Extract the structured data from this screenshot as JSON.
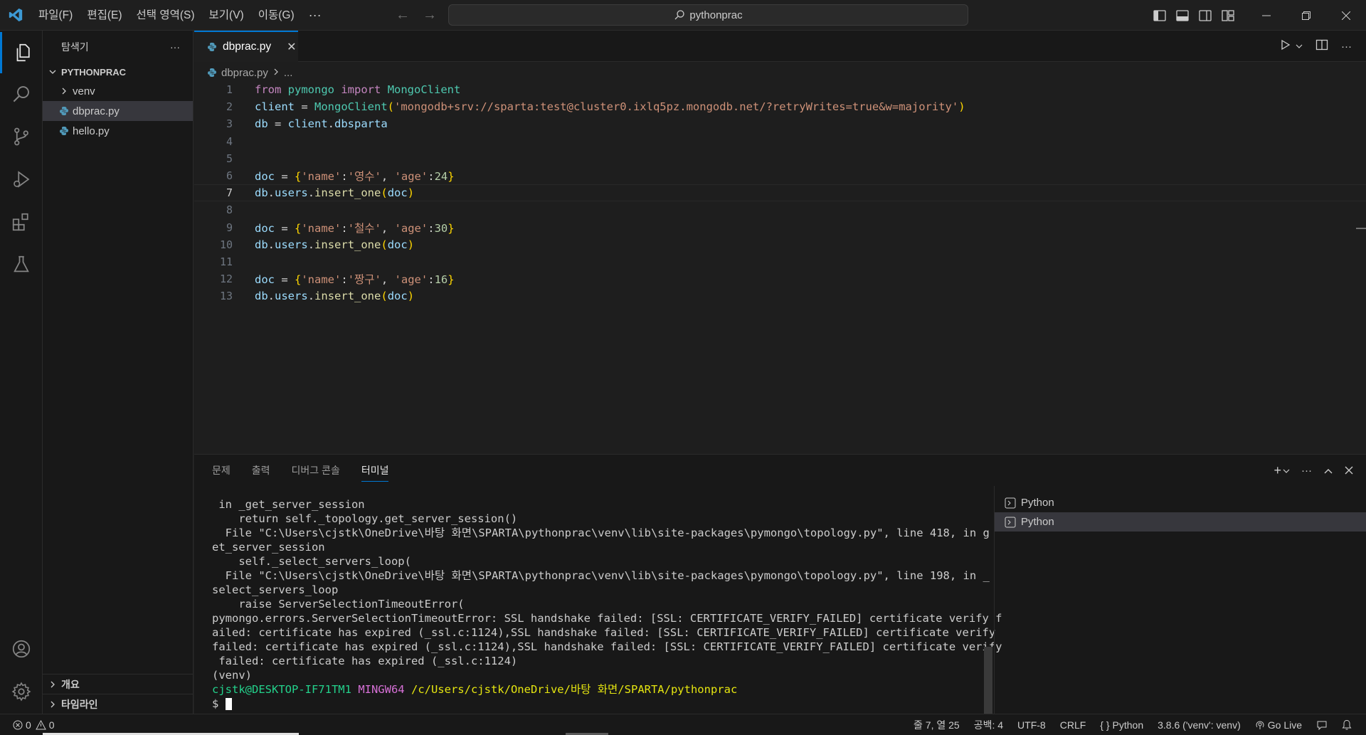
{
  "menu": {
    "items": [
      "파일(F)",
      "편집(E)",
      "선택 영역(S)",
      "보기(V)",
      "이동(G)"
    ],
    "more": "···"
  },
  "search": {
    "text": "pythonprac"
  },
  "sidebar": {
    "title": "탐색기",
    "more": "···",
    "project": "PYTHONPRAC",
    "tree": [
      {
        "label": "venv",
        "type": "folder"
      },
      {
        "label": "dbprac.py",
        "type": "file",
        "selected": true
      },
      {
        "label": "hello.py",
        "type": "file"
      }
    ],
    "outline": "개요",
    "timeline": "타임라인"
  },
  "editor": {
    "tab_label": "dbprac.py",
    "breadcrumb_file": "dbprac.py",
    "breadcrumb_rest": "...",
    "current_line": 7,
    "lines": [
      {
        "n": "1",
        "parts": [
          [
            "kw",
            "from"
          ],
          [
            "op",
            " "
          ],
          [
            "mod",
            "pymongo"
          ],
          [
            "op",
            " "
          ],
          [
            "kw",
            "import"
          ],
          [
            "op",
            " "
          ],
          [
            "mod",
            "MongoClient"
          ]
        ]
      },
      {
        "n": "2",
        "parts": [
          [
            "var",
            "client"
          ],
          [
            "op",
            " = "
          ],
          [
            "mod",
            "MongoClient"
          ],
          [
            "br1",
            "("
          ],
          [
            "str",
            "'mongodb+srv://sparta:test@cluster0.ixlq5pz.mongodb.net/?retryWrites=true&w=majority'"
          ],
          [
            "br1",
            ")"
          ]
        ]
      },
      {
        "n": "3",
        "parts": [
          [
            "var",
            "db"
          ],
          [
            "op",
            " = "
          ],
          [
            "var",
            "client"
          ],
          [
            "op",
            "."
          ],
          [
            "var",
            "dbsparta"
          ]
        ]
      },
      {
        "n": "4",
        "parts": []
      },
      {
        "n": "5",
        "parts": []
      },
      {
        "n": "6",
        "parts": [
          [
            "var",
            "doc"
          ],
          [
            "op",
            " = "
          ],
          [
            "br1",
            "{"
          ],
          [
            "str",
            "'name'"
          ],
          [
            "op",
            ":"
          ],
          [
            "str",
            "'영수'"
          ],
          [
            "op",
            ", "
          ],
          [
            "str",
            "'age'"
          ],
          [
            "op",
            ":"
          ],
          [
            "num",
            "24"
          ],
          [
            "br1",
            "}"
          ]
        ]
      },
      {
        "n": "7",
        "parts": [
          [
            "var",
            "db"
          ],
          [
            "op",
            "."
          ],
          [
            "var",
            "users"
          ],
          [
            "op",
            "."
          ],
          [
            "fn",
            "insert_one"
          ],
          [
            "br1",
            "("
          ],
          [
            "var",
            "doc"
          ],
          [
            "br1",
            ")"
          ]
        ]
      },
      {
        "n": "8",
        "parts": []
      },
      {
        "n": "9",
        "parts": [
          [
            "var",
            "doc"
          ],
          [
            "op",
            " = "
          ],
          [
            "br1",
            "{"
          ],
          [
            "str",
            "'name'"
          ],
          [
            "op",
            ":"
          ],
          [
            "str",
            "'철수'"
          ],
          [
            "op",
            ", "
          ],
          [
            "str",
            "'age'"
          ],
          [
            "op",
            ":"
          ],
          [
            "num",
            "30"
          ],
          [
            "br1",
            "}"
          ]
        ]
      },
      {
        "n": "10",
        "parts": [
          [
            "var",
            "db"
          ],
          [
            "op",
            "."
          ],
          [
            "var",
            "users"
          ],
          [
            "op",
            "."
          ],
          [
            "fn",
            "insert_one"
          ],
          [
            "br1",
            "("
          ],
          [
            "var",
            "doc"
          ],
          [
            "br1",
            ")"
          ]
        ]
      },
      {
        "n": "11",
        "parts": []
      },
      {
        "n": "12",
        "parts": [
          [
            "var",
            "doc"
          ],
          [
            "op",
            " = "
          ],
          [
            "br1",
            "{"
          ],
          [
            "str",
            "'name'"
          ],
          [
            "op",
            ":"
          ],
          [
            "str",
            "'짱구'"
          ],
          [
            "op",
            ", "
          ],
          [
            "str",
            "'age'"
          ],
          [
            "op",
            ":"
          ],
          [
            "num",
            "16"
          ],
          [
            "br1",
            "}"
          ]
        ]
      },
      {
        "n": "13",
        "parts": [
          [
            "var",
            "db"
          ],
          [
            "op",
            "."
          ],
          [
            "var",
            "users"
          ],
          [
            "op",
            "."
          ],
          [
            "fn",
            "insert_one"
          ],
          [
            "br1",
            "("
          ],
          [
            "var",
            "doc"
          ],
          [
            "br1",
            ")"
          ]
        ]
      }
    ]
  },
  "panel": {
    "tabs": [
      "문제",
      "출력",
      "디버그 콘솔",
      "터미널"
    ],
    "active_tab": 3,
    "terminal_lines": [
      " in _get_server_session",
      "    return self._topology.get_server_session()",
      "  File \"C:\\Users\\cjstk\\OneDrive\\바탕 화면\\SPARTA\\pythonprac\\venv\\lib\\site-packages\\pymongo\\topology.py\", line 418, in g",
      "et_server_session",
      "    self._select_servers_loop(",
      "  File \"C:\\Users\\cjstk\\OneDrive\\바탕 화면\\SPARTA\\pythonprac\\venv\\lib\\site-packages\\pymongo\\topology.py\", line 198, in _",
      "select_servers_loop",
      "    raise ServerSelectionTimeoutError(",
      "pymongo.errors.ServerSelectionTimeoutError: SSL handshake failed: [SSL: CERTIFICATE_VERIFY_FAILED] certificate verify f",
      "ailed: certificate has expired (_ssl.c:1124),SSL handshake failed: [SSL: CERTIFICATE_VERIFY_FAILED] certificate verify ",
      "failed: certificate has expired (_ssl.c:1124),SSL handshake failed: [SSL: CERTIFICATE_VERIFY_FAILED] certificate verify",
      " failed: certificate has expired (_ssl.c:1124)",
      "(venv)"
    ],
    "prompt": {
      "user": "cjstk@DESKTOP-IF71TM1",
      "env": "MINGW64",
      "path": "/c/Users/cjstk/OneDrive/바탕 화면/SPARTA/pythonprac",
      "symbol": "$"
    },
    "terminals": [
      "Python",
      "Python"
    ],
    "active_terminal": 1
  },
  "status": {
    "errors": "0",
    "warnings": "0",
    "position": "줄 7, 열 25",
    "spaces": "공백: 4",
    "encoding": "UTF-8",
    "eol": "CRLF",
    "language": "Python",
    "interpreter": "3.8.6 ('venv': venv)",
    "golive": "Go Live"
  },
  "colors": {
    "accent": "#0078d4",
    "python_icon": "#519aba"
  }
}
